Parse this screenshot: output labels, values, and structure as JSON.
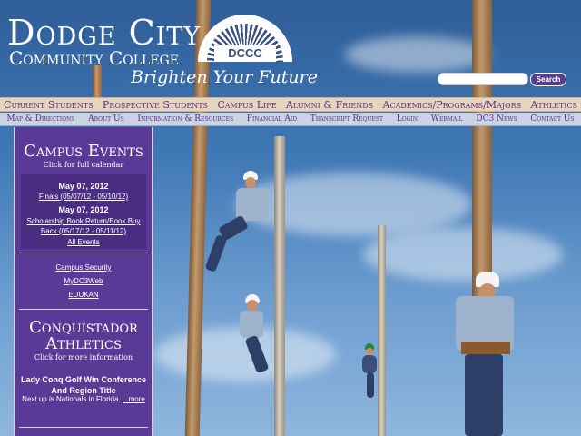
{
  "header": {
    "logo_line1": "Dodge City",
    "logo_line2": "Community College",
    "tagline": "Brighten Your Future",
    "badge": "DCCC"
  },
  "search": {
    "placeholder": "",
    "button_label": "Search"
  },
  "main_nav": [
    "Current Students",
    "Prospective Students",
    "Campus Life",
    "Alumni & Friends",
    "Academics/Programs/Majors",
    "Athletics"
  ],
  "sub_nav": [
    "Map & Directions",
    "About Us",
    "Information & Resources",
    "Financial Aid",
    "Transcript Request",
    "Login",
    "Webmail",
    "DC3 News",
    "Contact Us"
  ],
  "sidebar": {
    "events_title": "Campus Events",
    "events_subtitle": "Click for full calendar",
    "events": [
      {
        "date": "May 07, 2012",
        "title": "Finals (05/07/12 - 05/10/12)"
      },
      {
        "date": "May 07, 2012",
        "title": "Scholarship Book Return/Book Buy Back (05/17/12 - 05/11/12)"
      }
    ],
    "all_events": "All Events",
    "links": [
      "Campus Security",
      "MyDC3Web",
      "EDUKAN"
    ],
    "athletics_title_1": "Conquistador",
    "athletics_title_2": "Athletics",
    "athletics_subtitle": "Click for more information",
    "news_headline": "Lady Conq Golf Win Conference And Region Title",
    "news_text": "Next up is Nationals in Florida.",
    "news_more": "...more"
  },
  "colors": {
    "accent": "#5b3a97",
    "nav_bg": "#e6d4bd",
    "subnav_bg": "#c9d3e3",
    "nav_text": "#5b2d8c"
  }
}
